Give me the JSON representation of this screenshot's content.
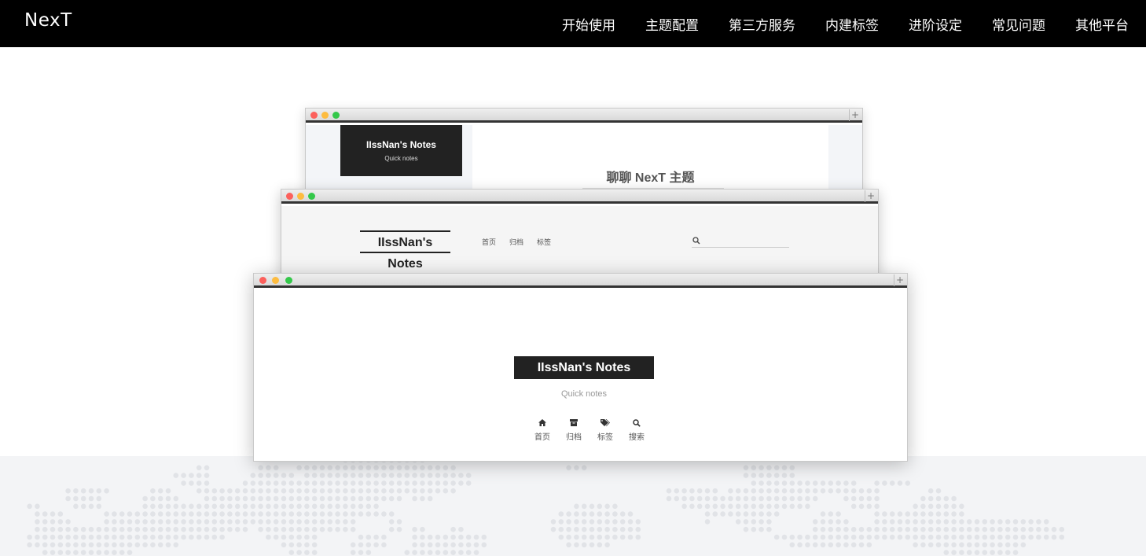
{
  "header": {
    "brand": "NexT",
    "nav": [
      {
        "label": "开始使用"
      },
      {
        "label": "主题配置"
      },
      {
        "label": "第三方服务"
      },
      {
        "label": "内建标签"
      },
      {
        "label": "进阶设定"
      },
      {
        "label": "常见问题"
      },
      {
        "label": "其他平台"
      }
    ]
  },
  "preview": {
    "back": {
      "site_title": "IIssNan's Notes",
      "site_subtitle": "Quick notes",
      "post_title": "聊聊 NexT 主题"
    },
    "mid": {
      "site_title": "IIssNan's Notes",
      "menu": [
        "首页",
        "归档",
        "标签"
      ]
    },
    "front": {
      "site_title": "IIssNan's Notes",
      "site_subtitle": "Quick notes",
      "menu": [
        {
          "icon": "home-icon",
          "label": "首页"
        },
        {
          "icon": "archive-icon",
          "label": "归档"
        },
        {
          "icon": "tags-icon",
          "label": "标签"
        },
        {
          "icon": "search-icon",
          "label": "搜索"
        }
      ]
    },
    "window_controls": [
      "red",
      "yellow",
      "green"
    ],
    "plus_glyph": "+"
  },
  "colors": {
    "topbar": "#000000",
    "map_background": "#f3f4f6",
    "map_dots": "#e1e3e7",
    "dot_red": "#fc605c",
    "dot_yellow": "#fdbc40",
    "dot_green": "#34c84a"
  }
}
